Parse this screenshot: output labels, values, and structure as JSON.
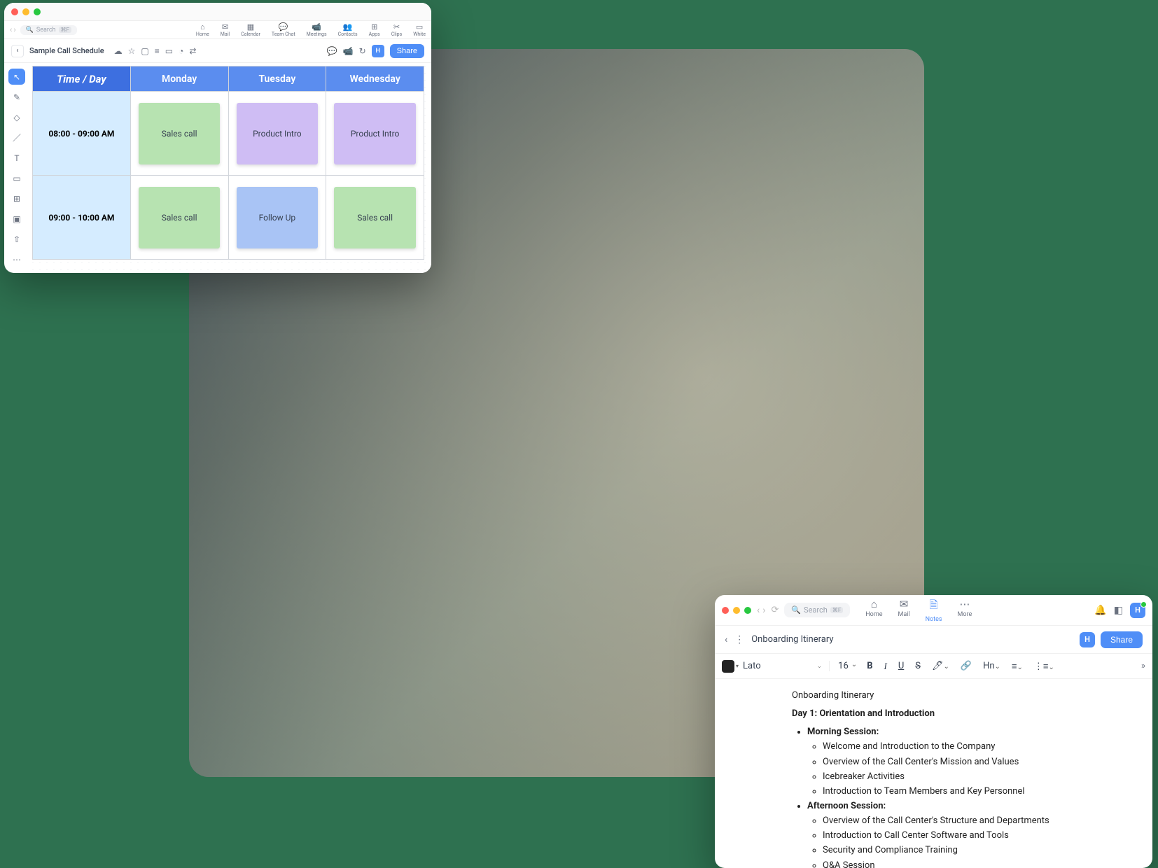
{
  "whiteboard": {
    "search_placeholder": "Search",
    "search_shortcut": "⌘F",
    "apps": [
      {
        "icon": "⌂",
        "label": "Home"
      },
      {
        "icon": "✉",
        "label": "Mail"
      },
      {
        "icon": "▦",
        "label": "Calendar"
      },
      {
        "icon": "💬",
        "label": "Team Chat"
      },
      {
        "icon": "📹",
        "label": "Meetings"
      },
      {
        "icon": "👥",
        "label": "Contacts"
      },
      {
        "icon": "⊞",
        "label": "Apps"
      },
      {
        "icon": "✂",
        "label": "Clips"
      },
      {
        "icon": "▭",
        "label": "White"
      }
    ],
    "doc_title": "Sample Call Schedule",
    "avatar_initial": "H",
    "share_label": "Share",
    "schedule": {
      "head_timeday": "Time / Day",
      "days": [
        "Monday",
        "Tuesday",
        "Wednesday"
      ],
      "rows": [
        {
          "time": "08:00 - 09:00 AM",
          "cells": [
            {
              "text": "Sales call",
              "color": "green"
            },
            {
              "text": "Product Intro",
              "color": "purple"
            },
            {
              "text": "Product Intro",
              "color": "purple"
            }
          ]
        },
        {
          "time": "09:00 - 10:00 AM",
          "cells": [
            {
              "text": "Sales call",
              "color": "green"
            },
            {
              "text": "Follow Up",
              "color": "blue"
            },
            {
              "text": "Sales call",
              "color": "green"
            }
          ]
        }
      ]
    }
  },
  "notes": {
    "search_placeholder": "Search",
    "search_shortcut": "⌘F",
    "apps": [
      {
        "icon": "⌂",
        "label": "Home",
        "active": false
      },
      {
        "icon": "✉",
        "label": "Mail",
        "active": false
      },
      {
        "icon": "🗎",
        "label": "Notes",
        "active": true
      },
      {
        "icon": "⋯",
        "label": "More",
        "active": false
      }
    ],
    "avatar_initial": "H",
    "doc_title": "Onboarding Itinerary",
    "share_label": "Share",
    "format": {
      "font": "Lato",
      "size": "16",
      "heading": "Hn"
    },
    "content": {
      "heading": "Onboarding Itinerary",
      "day_heading": "Day 1: Orientation and Introduction",
      "sessions": [
        {
          "label": "Morning Session:",
          "items": [
            "Welcome and Introduction to the Company",
            "Overview of the Call Center's Mission and Values",
            "Icebreaker Activities",
            "Introduction to Team Members and Key Personnel"
          ]
        },
        {
          "label": "Afternoon Session:",
          "items": [
            "Overview of the Call Center's Structure and Departments",
            "Introduction to Call Center Software and Tools",
            "Security and Compliance Training",
            "Q&A Session"
          ]
        }
      ]
    }
  }
}
